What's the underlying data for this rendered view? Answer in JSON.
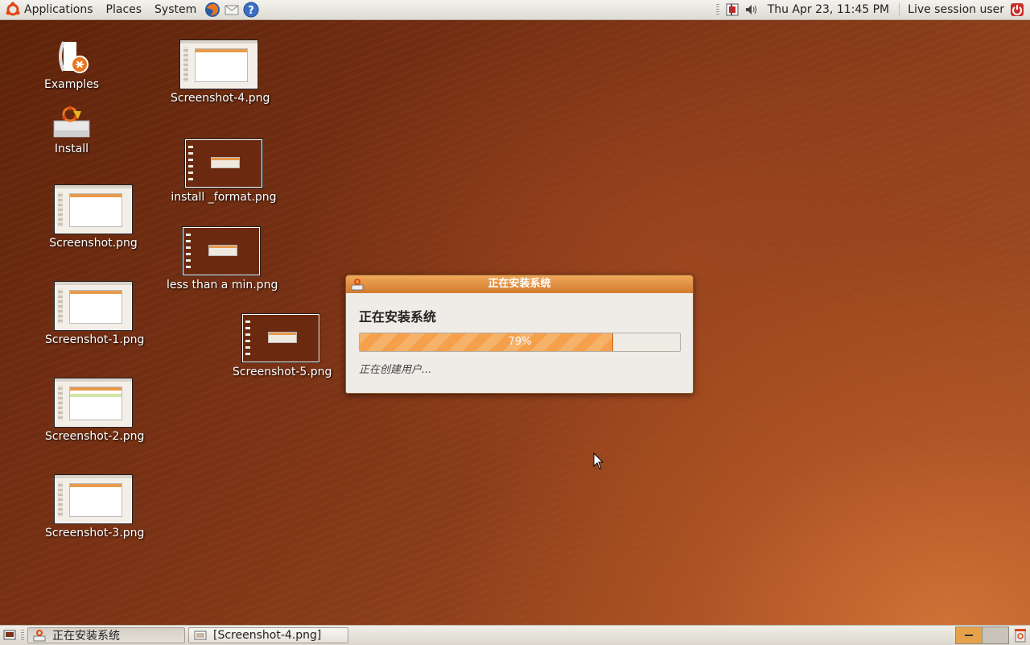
{
  "top_panel": {
    "menus": [
      "Applications",
      "Places",
      "System"
    ],
    "clock": "Thu Apr 23, 11:45 PM",
    "user": "Live session user"
  },
  "desktop_icons": [
    {
      "label": "Examples"
    },
    {
      "label": "Install"
    },
    {
      "label": "Screenshot.png"
    },
    {
      "label": "Screenshot-1.png"
    },
    {
      "label": "Screenshot-2.png"
    },
    {
      "label": "Screenshot-3.png"
    },
    {
      "label": "Screenshot-4.png"
    },
    {
      "label": "install _format.png"
    },
    {
      "label": "less than a min.png"
    },
    {
      "label": "Screenshot-5.png"
    }
  ],
  "dialog": {
    "title": "正在安装系统",
    "heading": "正在安装系统",
    "progress_percent": 79,
    "progress_label": "79%",
    "status": "正在创建用户..."
  },
  "taskbar": {
    "tasks": [
      "正在安装系统",
      "[Screenshot-4.png]"
    ]
  },
  "colors": {
    "accent": "#e98a3a",
    "titlebar": "#d27a2e",
    "desktop": "#7a3416"
  }
}
